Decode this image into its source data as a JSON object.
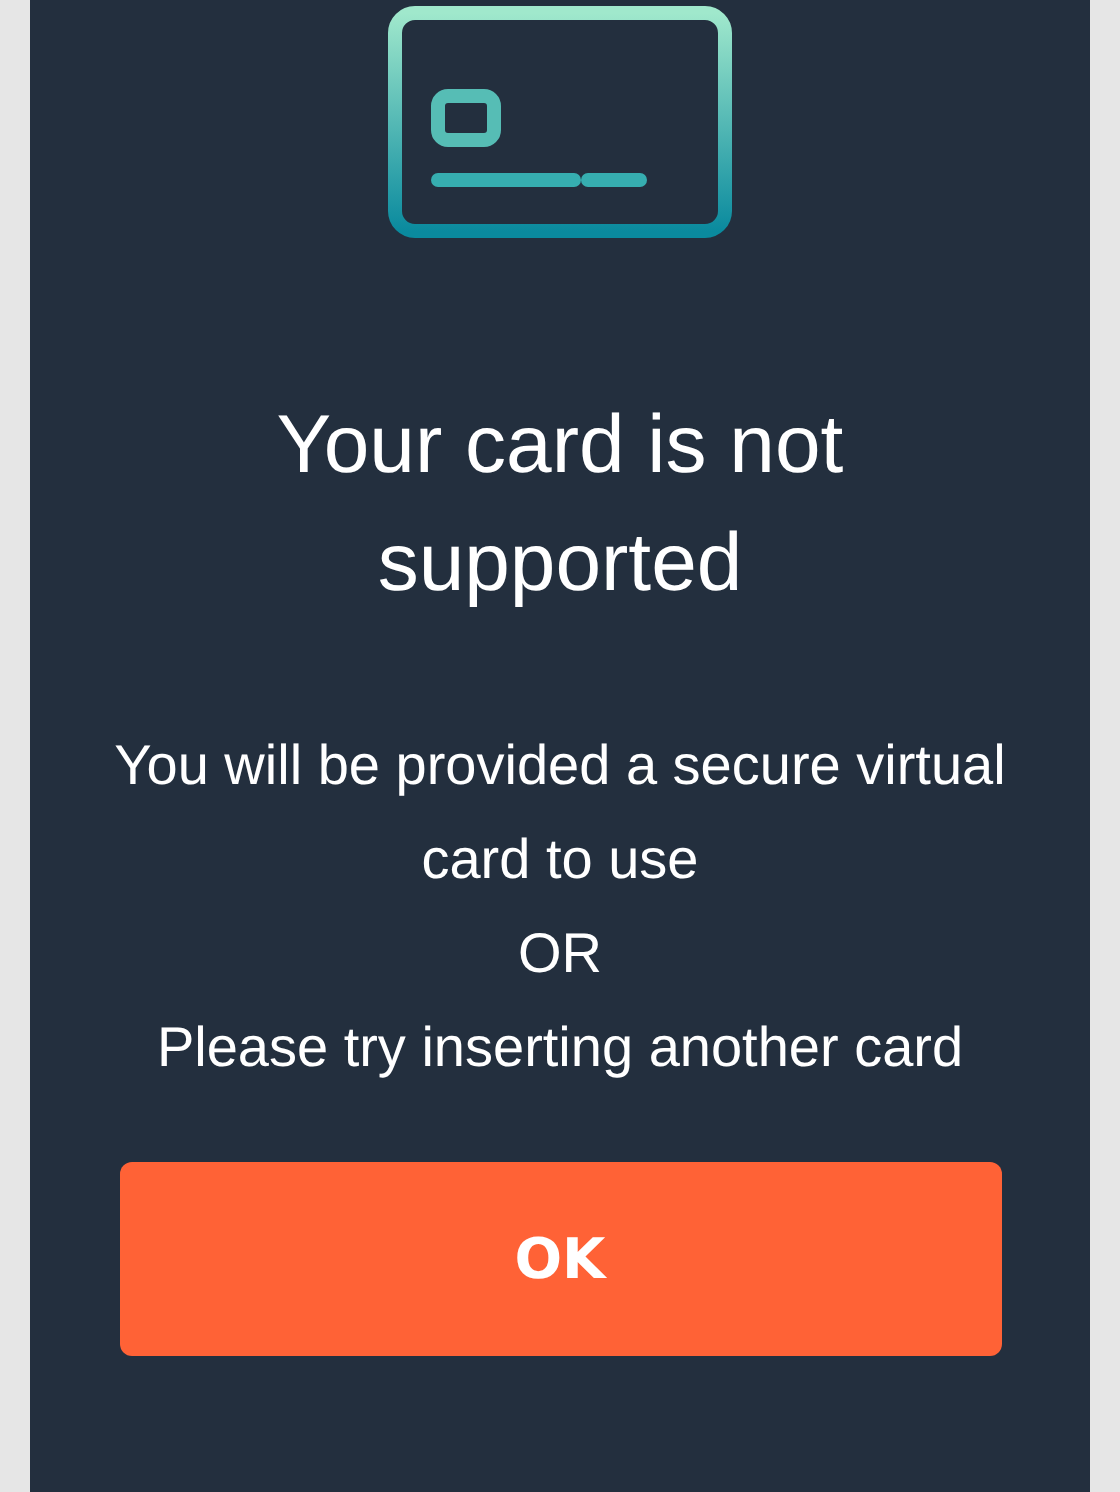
{
  "title": "Your card is not supported",
  "message": [
    "You will be provided a secure virtual card to use",
    "OR",
    "Please try inserting another card"
  ],
  "buttons": [
    {
      "label": "OK",
      "kind": "primary"
    }
  ]
}
